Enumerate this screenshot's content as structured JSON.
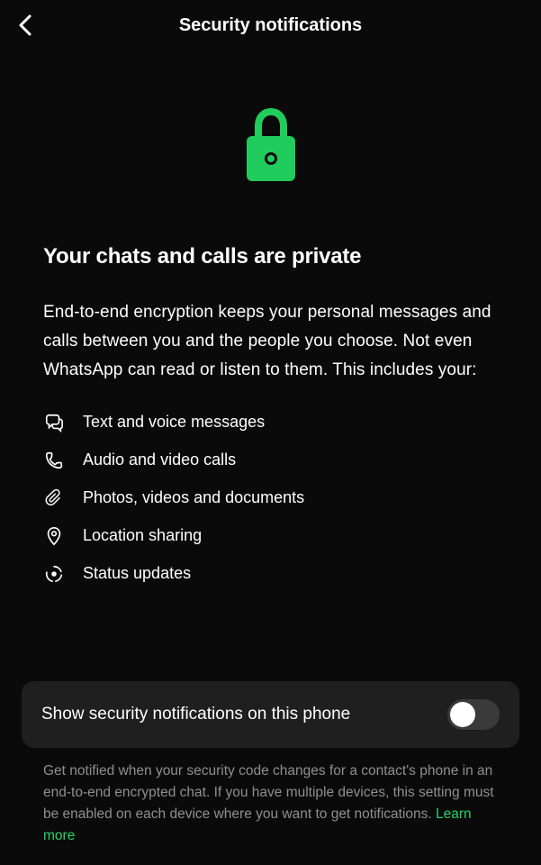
{
  "header": {
    "title": "Security notifications"
  },
  "main": {
    "heading": "Your chats and calls are private",
    "description": "End-to-end encryption keeps your personal messages and calls between you and the people you choose. Not even WhatsApp can read or listen to them. This includes your:",
    "features": [
      {
        "label": "Text and voice messages"
      },
      {
        "label": "Audio and video calls"
      },
      {
        "label": "Photos, videos and documents"
      },
      {
        "label": "Location sharing"
      },
      {
        "label": "Status updates"
      }
    ]
  },
  "toggle": {
    "label": "Show security notifications on this phone",
    "enabled": false
  },
  "helper": {
    "text": "Get notified when your security code changes for a contact's phone in an end-to-end encrypted chat. If you have multiple devices, this setting must be enabled on each device where you want to get notifications. ",
    "link": "Learn more"
  },
  "colors": {
    "accent": "#25d366",
    "background": "#0a0a0a",
    "card": "#1f1f1f"
  }
}
